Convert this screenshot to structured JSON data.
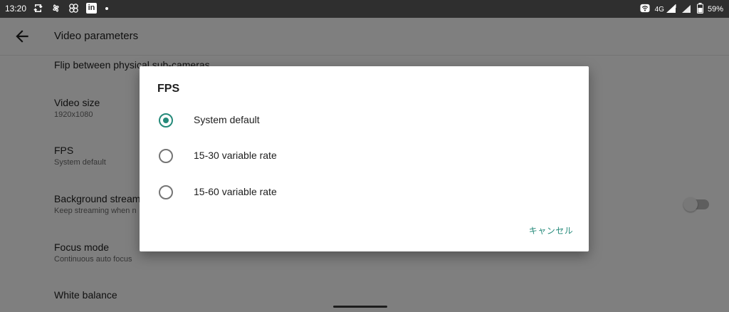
{
  "status_bar": {
    "time": "13:20",
    "notification_icons": [
      "sync-icon",
      "pinwheel-icon",
      "pinwheel-alt-icon",
      "linkedin-icon",
      "dot-icon"
    ],
    "linkedin_label": "in",
    "network": "4G",
    "battery": "59%"
  },
  "app_bar": {
    "title": "Video parameters"
  },
  "settings": {
    "items": [
      {
        "title": "Flip between physical sub-cameras",
        "summary": ""
      },
      {
        "title": "Video size",
        "summary": "1920x1080"
      },
      {
        "title": "FPS",
        "summary": "System default"
      },
      {
        "title": "Background stream",
        "summary": "Keep streaming when n"
      },
      {
        "title": "Focus mode",
        "summary": "Continuous auto focus"
      },
      {
        "title": "White balance",
        "summary": ""
      }
    ],
    "background_stream_enabled": false
  },
  "dialog": {
    "title": "FPS",
    "options": [
      {
        "label": "System default",
        "selected": true
      },
      {
        "label": "15-30 variable rate",
        "selected": false
      },
      {
        "label": "15-60 variable rate",
        "selected": false
      }
    ],
    "cancel_label": "キャンセル"
  },
  "colors": {
    "accent": "#258a7a",
    "status_bar": "#2f2f2f",
    "scrim": "#00000080"
  }
}
